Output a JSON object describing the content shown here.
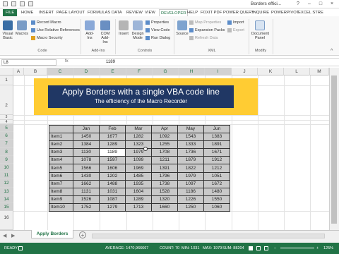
{
  "window": {
    "title": "Borders effici..."
  },
  "tabs": [
    "FILE",
    "HOME",
    "INSERT",
    "PAGE LAYOUT",
    "FORMULAS",
    "DATA",
    "REVIEW",
    "VIEW",
    "DEVELOPER",
    "HELP",
    "FOXIT PDF",
    "POWER QUERY",
    "INQUIRE",
    "POWERPIVOT",
    "EXCEL STRE"
  ],
  "ribbon": {
    "code": {
      "visual_basic": "Visual Basic",
      "macros": "Macros",
      "record": "Record Macro",
      "relative": "Use Relative References",
      "security": "Macro Security",
      "label": "Code"
    },
    "addins": {
      "addins": "Add-Ins",
      "com": "COM Add-Ins",
      "label": "Add-Ins"
    },
    "controls": {
      "insert": "Insert",
      "design": "Design Mode",
      "properties": "Properties",
      "view_code": "View Code",
      "run_dialog": "Run Dialog",
      "label": "Controls"
    },
    "xml": {
      "source": "Source",
      "map_props": "Map Properties",
      "expansion": "Expansion Packs",
      "refresh": "Refresh Data",
      "import": "Import",
      "export": "Export",
      "label": "XML"
    },
    "modify": {
      "doc_panel": "Document Panel",
      "label": "Modify"
    }
  },
  "formula_bar": {
    "name_box": "L8",
    "fx": "fx",
    "value": "1189"
  },
  "columns": [
    "A",
    "B",
    "C",
    "D",
    "E",
    "F",
    "G",
    "H",
    "I",
    "J",
    "K",
    "L",
    "M"
  ],
  "rows": [
    "1",
    "2",
    "3",
    "4",
    "5",
    "6",
    "7",
    "8",
    "9",
    "10",
    "11",
    "12",
    "13",
    "14",
    "15",
    "16"
  ],
  "banner": {
    "title": "Apply Borders with a single VBA code line",
    "subtitle": "The efficiency of the Macro Recorder"
  },
  "table": {
    "headers": [
      "",
      "Jan",
      "Feb",
      "Mar",
      "Apr",
      "May",
      "Jun"
    ],
    "rows": [
      [
        "Item1",
        "1450",
        "1677",
        "1282",
        "1092",
        "1543",
        "1383"
      ],
      [
        "Item2",
        "1384",
        "1289",
        "1323",
        "1255",
        "1333",
        "1891"
      ],
      [
        "Item3",
        "1130",
        "1189",
        "1979",
        "1708",
        "1736",
        "1671"
      ],
      [
        "Item4",
        "1078",
        "1597",
        "1099",
        "1211",
        "1879",
        "1912"
      ],
      [
        "Item5",
        "1566",
        "1606",
        "1969",
        "1391",
        "1822",
        "1212"
      ],
      [
        "Item6",
        "1430",
        "1202",
        "1485",
        "1796",
        "1979",
        "1051"
      ],
      [
        "Item7",
        "1662",
        "1488",
        "1935",
        "1738",
        "1097",
        "1672"
      ],
      [
        "Item8",
        "1131",
        "1031",
        "1604",
        "1528",
        "1186",
        "1480"
      ],
      [
        "Item9",
        "1526",
        "1087",
        "1289",
        "1320",
        "1226",
        "1550"
      ],
      [
        "Item10",
        "1752",
        "1279",
        "1713",
        "1660",
        "1250",
        "1060"
      ]
    ]
  },
  "sheet_tabs": {
    "active": "Apply Borders",
    "add": "+"
  },
  "status": {
    "ready": "READY",
    "average": "AVERAGE: 1470,966667",
    "count": "COUNT: 70",
    "min": "MIN: 1031",
    "max": "MAX: 1979",
    "sum": "SUM: 88204",
    "zoom": "125%"
  }
}
